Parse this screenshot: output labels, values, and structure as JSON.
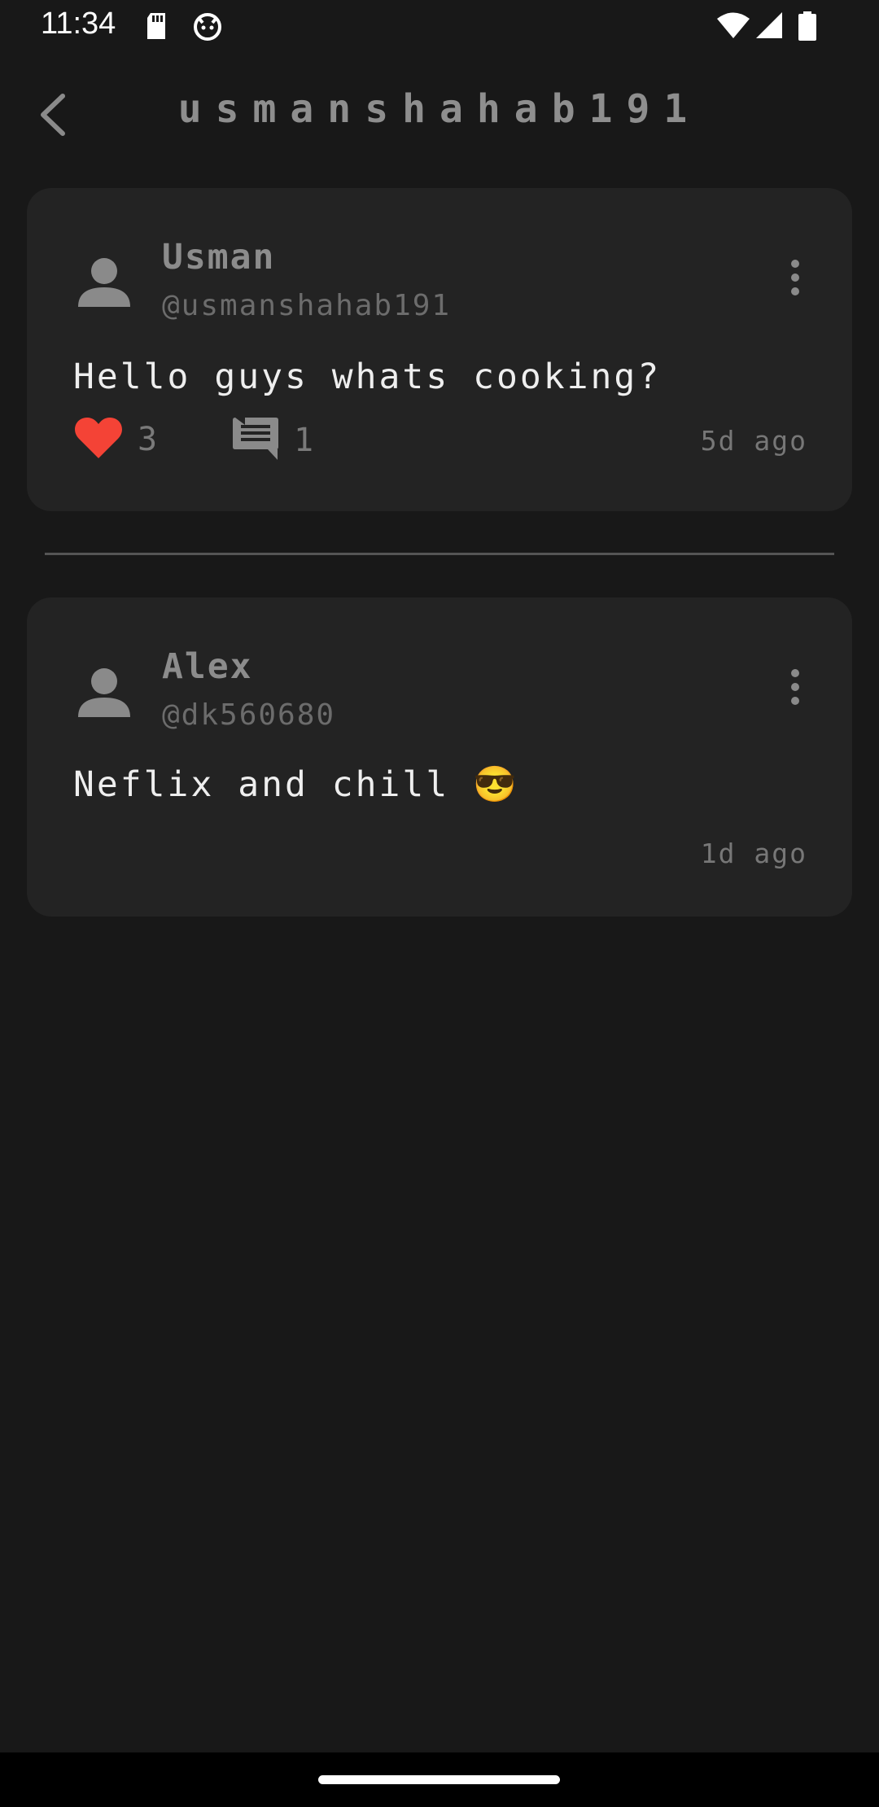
{
  "status_bar": {
    "time": "11:34",
    "icons": [
      "sd-card-icon",
      "cat-notification-icon",
      "wifi-icon",
      "signal-icon",
      "battery-icon"
    ]
  },
  "header": {
    "title": "usmanshahab191",
    "back_icon": "chevron-left-icon"
  },
  "posts": [
    {
      "author_name": "Usman",
      "author_handle": "@usmanshahab191",
      "text": "Hello guys whats cooking?",
      "likes": "3",
      "comments": "1",
      "time_ago": "5d ago",
      "like_color": "#f44336"
    },
    {
      "author_name": "Alex",
      "author_handle": "@dk560680",
      "text": "Neflix and chill 😎",
      "time_ago": "1d ago"
    }
  ],
  "colors": {
    "background": "#181818",
    "card": "#232323",
    "accent_like": "#f44336"
  }
}
